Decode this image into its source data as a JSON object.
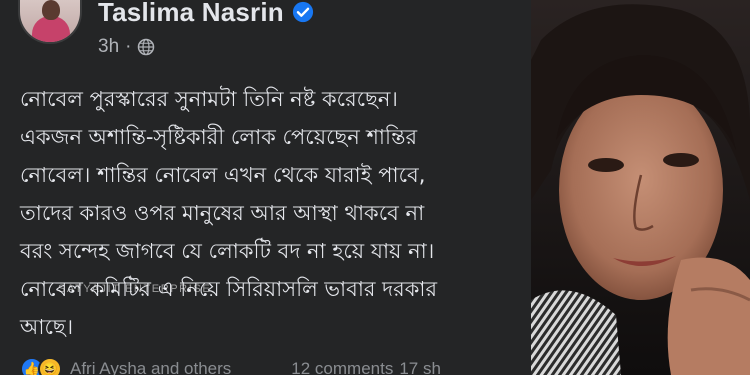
{
  "post": {
    "author": "Taslima Nasrin",
    "time": "3h",
    "visibility_icon": "globe-icon",
    "verified_icon": "verified-badge-icon",
    "lines": [
      "নোবেল পুরস্কারের সুনামটা তিনি নষ্ট করেছেন।",
      "একজন অশান্তি-সৃষ্টিকারী লোক পেয়েছেন শান্তির",
      "নোবেল। শান্তির নোবেল এখন থেকে যারাই পাবে,",
      "তাদের কারও ওপর মানুষের আর আস্থা থাকবে না",
      "বরং সন্দেহ জাগবে যে লোকটি বদ না হয়ে যায় না।",
      "নোবেল কমিটির এ নিয়ে সিরিয়াসলি ভাবার দরকার",
      "আছে।"
    ],
    "watermark": "SATYAJIT ENTERPRISE",
    "reactions": {
      "reacted_by": "Afri Aysha and others",
      "comments": "12 comments",
      "shares": "17 sh"
    }
  },
  "colors": {
    "background": "#242526",
    "text": "#e4e6eb",
    "muted": "#b0b3b8",
    "verified": "#1877f2"
  }
}
